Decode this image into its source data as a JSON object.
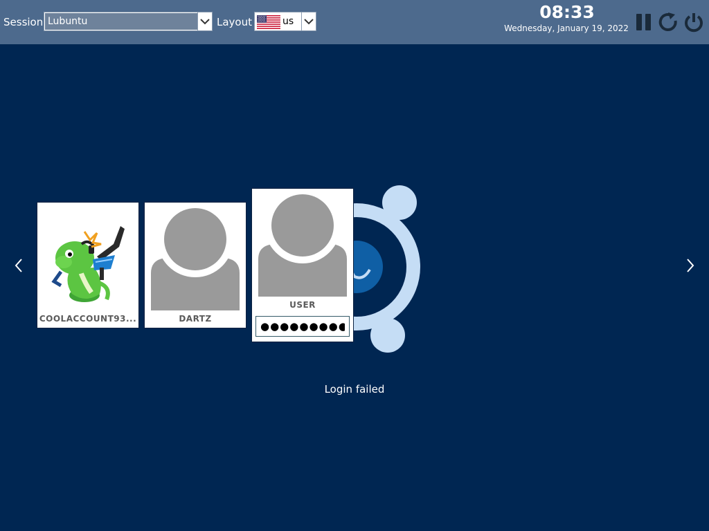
{
  "topbar": {
    "session_label": "Session",
    "session_value": "Lubuntu",
    "layout_label": "Layout",
    "layout_value": "us",
    "time": "08:33",
    "date": "Wednesday, January 19, 2022"
  },
  "users": [
    {
      "name": "COOLACCOUNT93...",
      "avatar": "konqi-mascot-icon"
    },
    {
      "name": "DARTZ",
      "avatar": "default-avatar-icon"
    },
    {
      "name": "USER",
      "avatar": "default-avatar-icon"
    }
  ],
  "password": {
    "value": "●●●●●●●●●"
  },
  "status": {
    "message": "Login failed"
  },
  "colors": {
    "background": "#002652",
    "topbar": "#4d6a8d",
    "logo_light": "#c5ddf5",
    "logo_accent": "#0f5fa5"
  },
  "icons": {
    "suspend": "pause-icon",
    "reboot": "reboot-icon",
    "shutdown": "power-icon",
    "prev": "chevron-left-icon",
    "next": "chevron-right-icon"
  }
}
